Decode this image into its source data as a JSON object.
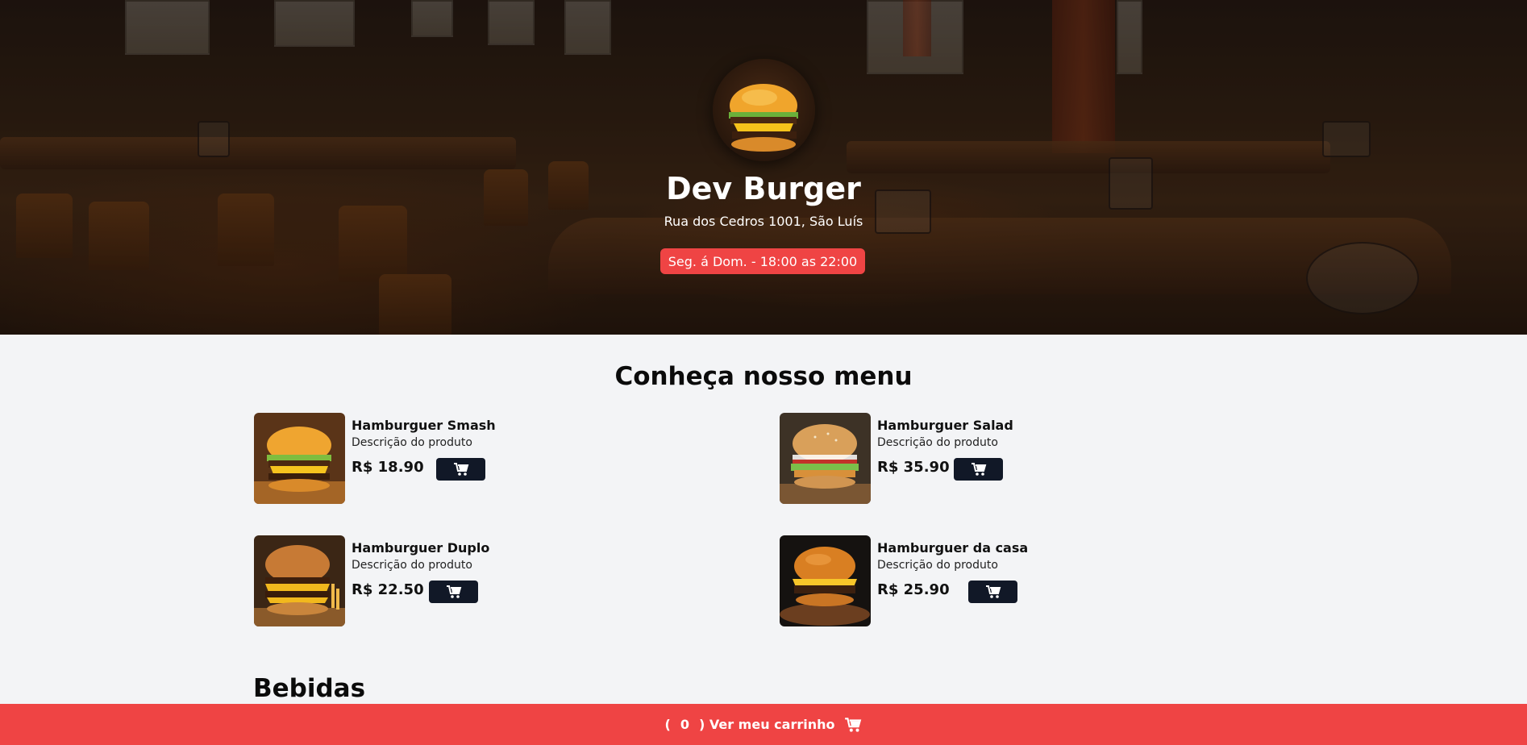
{
  "header": {
    "title": "Dev Burger",
    "address": "Rua dos Cedros 1001, São Luís",
    "hours": "Seg. á Dom. - 18:00 as 22:00",
    "logo_icon": "burger-logo-icon"
  },
  "menu": {
    "title": "Conheça nosso menu",
    "items": [
      {
        "name": "Hamburguer Smash",
        "description": "Descrição do produto",
        "price": "R$ 18.90",
        "icon": "cart-icon"
      },
      {
        "name": "Hamburguer Salad",
        "description": "Descrição do produto",
        "price": "R$ 35.90",
        "icon": "cart-icon"
      },
      {
        "name": "Hamburguer Duplo",
        "description": "Descrição do produto",
        "price": "R$ 22.50",
        "icon": "cart-icon"
      },
      {
        "name": "Hamburguer da casa",
        "description": "Descrição do produto",
        "price": "R$ 25.90",
        "icon": "cart-icon"
      }
    ]
  },
  "drinks": {
    "title": "Bebidas"
  },
  "cart_bar": {
    "open_paren": "(",
    "count": "0",
    "label": ") Ver meu carrinho",
    "icon": "cart-icon"
  },
  "colors": {
    "accent": "#ef4444",
    "button_dark": "#111827",
    "page_bg": "#f3f4f6"
  }
}
